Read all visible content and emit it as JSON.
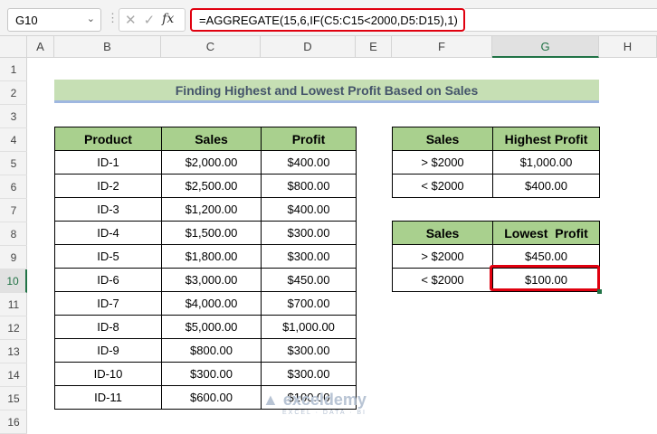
{
  "name_box": "G10",
  "formula": "=AGGREGATE(15,6,IF(C5:C15<2000,D5:D15),1)",
  "columns": [
    "A",
    "B",
    "C",
    "D",
    "E",
    "F",
    "G",
    "H"
  ],
  "rows": [
    "1",
    "2",
    "3",
    "4",
    "5",
    "6",
    "7",
    "8",
    "9",
    "10",
    "11",
    "12",
    "13",
    "14",
    "15",
    "16"
  ],
  "title": "Finding Highest and Lowest Profit Based on Sales",
  "main_table": {
    "headers": [
      "Product",
      "Sales",
      "Profit"
    ],
    "rows": [
      [
        "ID-1",
        "$2,000.00",
        "$400.00"
      ],
      [
        "ID-2",
        "$2,500.00",
        "$800.00"
      ],
      [
        "ID-3",
        "$1,200.00",
        "$400.00"
      ],
      [
        "ID-4",
        "$1,500.00",
        "$300.00"
      ],
      [
        "ID-5",
        "$1,800.00",
        "$300.00"
      ],
      [
        "ID-6",
        "$3,000.00",
        "$450.00"
      ],
      [
        "ID-7",
        "$4,000.00",
        "$700.00"
      ],
      [
        "ID-8",
        "$5,000.00",
        "$1,000.00"
      ],
      [
        "ID-9",
        "$800.00",
        "$300.00"
      ],
      [
        "ID-10",
        "$300.00",
        "$300.00"
      ],
      [
        "ID-11",
        "$600.00",
        "$100.00"
      ]
    ]
  },
  "highest_table": {
    "headers": [
      "Sales",
      "Highest Profit"
    ],
    "rows": [
      [
        "> $2000",
        "$1,000.00"
      ],
      [
        "< $2000",
        "$400.00"
      ]
    ]
  },
  "lowest_table": {
    "headers": [
      "Sales",
      "Lowest  Profit"
    ],
    "rows": [
      [
        "> $2000",
        "$450.00"
      ],
      [
        "< $2000",
        "$100.00"
      ]
    ]
  },
  "watermark": {
    "name": "exceldemy",
    "tagline": "EXCEL · DATA · BI"
  }
}
